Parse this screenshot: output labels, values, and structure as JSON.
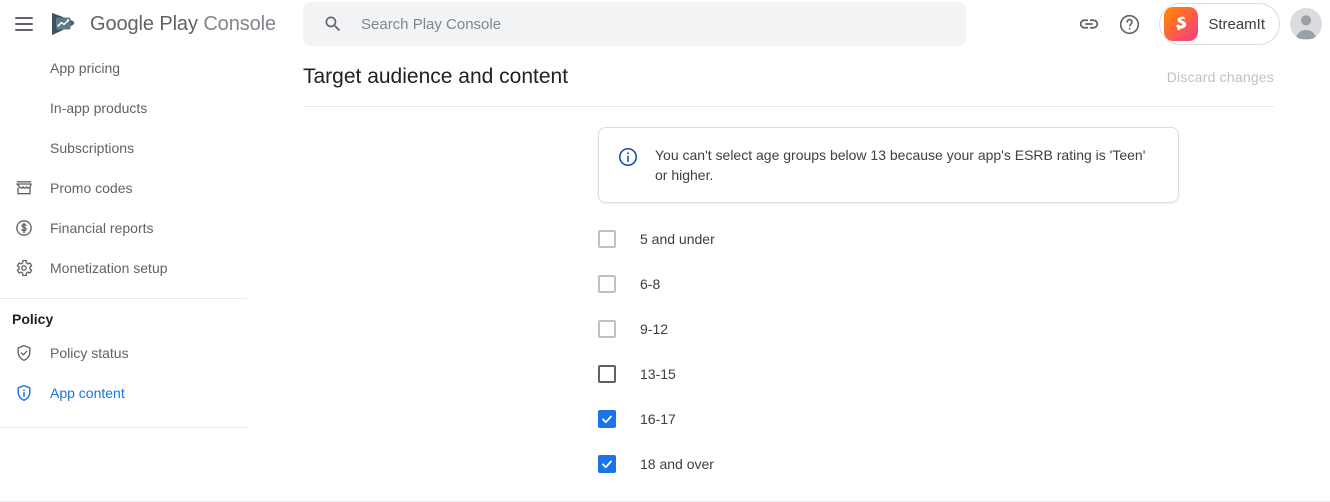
{
  "topbar": {
    "menu_icon": "hamburger-menu-icon",
    "brand_primary": "Google Play",
    "brand_secondary": "Console",
    "logo_icon": "google-play-console-logo",
    "search": {
      "icon": "search-icon",
      "placeholder": "Search Play Console",
      "value": ""
    },
    "link_icon": "link-icon",
    "help_icon": "help-circle-icon",
    "app_chip": {
      "icon": "streamit-app-icon",
      "name": "StreamIt"
    },
    "avatar_icon": "account-avatar-icon"
  },
  "sidebar": {
    "items": [
      {
        "label": "App pricing",
        "icon": "",
        "active": false
      },
      {
        "label": "In-app products",
        "icon": "",
        "active": false
      },
      {
        "label": "Subscriptions",
        "icon": "",
        "active": false
      },
      {
        "label": "Promo codes",
        "icon": "store-icon",
        "active": false
      },
      {
        "label": "Financial reports",
        "icon": "dollar-circle-icon",
        "active": false
      },
      {
        "label": "Monetization setup",
        "icon": "gear-icon",
        "active": false
      }
    ],
    "section_title": "Policy",
    "policy_items": [
      {
        "label": "Policy status",
        "icon": "shield-check-icon",
        "active": false
      },
      {
        "label": "App content",
        "icon": "shield-info-icon",
        "active": true
      }
    ]
  },
  "main": {
    "page_title": "Target audience and content",
    "discard_label": "Discard changes",
    "info_banner": {
      "icon": "info-circle-icon",
      "text": "You can't select age groups below 13 because your app's ESRB rating is 'Teen' or higher."
    },
    "age_groups": [
      {
        "label": "5 and under",
        "state": "disabled"
      },
      {
        "label": "6-8",
        "state": "disabled"
      },
      {
        "label": "9-12",
        "state": "disabled"
      },
      {
        "label": "13-15",
        "state": "unchecked"
      },
      {
        "label": "16-17",
        "state": "checked"
      },
      {
        "label": "18 and over",
        "state": "checked"
      }
    ]
  },
  "colors": {
    "accent_blue": "#1a73e8",
    "text_primary": "#202124",
    "text_secondary": "#5f6368",
    "disabled_gray": "#bdc1c6",
    "divider": "#e8eaed",
    "search_bg": "#f1f3f4",
    "info_icon_blue": "#174ea6"
  }
}
